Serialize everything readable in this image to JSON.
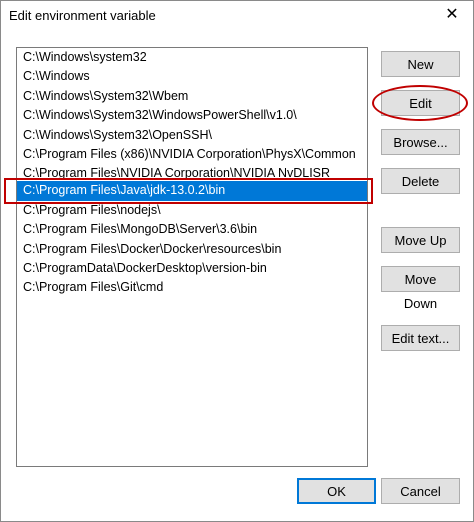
{
  "window": {
    "title": "Edit environment variable",
    "close_glyph": "✕"
  },
  "paths": [
    {
      "text": "C:\\Windows\\system32",
      "selected": false
    },
    {
      "text": "C:\\Windows",
      "selected": false
    },
    {
      "text": "C:\\Windows\\System32\\Wbem",
      "selected": false
    },
    {
      "text": "C:\\Windows\\System32\\WindowsPowerShell\\v1.0\\",
      "selected": false
    },
    {
      "text": "C:\\Windows\\System32\\OpenSSH\\",
      "selected": false
    },
    {
      "text": "C:\\Program Files (x86)\\NVIDIA Corporation\\PhysX\\Common",
      "selected": false
    },
    {
      "text": "C:\\Program Files\\NVIDIA Corporation\\NVIDIA NvDLISR",
      "selected": false,
      "clipped": true
    },
    {
      "text": "C:\\Program Files\\Java\\jdk-13.0.2\\bin",
      "selected": true
    },
    {
      "text": "C:\\Program Files\\nodejs\\",
      "selected": false
    },
    {
      "text": "C:\\Program Files\\MongoDB\\Server\\3.6\\bin",
      "selected": false
    },
    {
      "text": "C:\\Program Files\\Docker\\Docker\\resources\\bin",
      "selected": false
    },
    {
      "text": "C:\\ProgramData\\DockerDesktop\\version-bin",
      "selected": false
    },
    {
      "text": "C:\\Program Files\\Git\\cmd",
      "selected": false
    }
  ],
  "buttons": {
    "new": "New",
    "edit": "Edit",
    "browse": "Browse...",
    "delete": "Delete",
    "move_up": "Move Up",
    "move_down": "Move Down",
    "edit_text": "Edit text...",
    "ok": "OK",
    "cancel": "Cancel"
  },
  "colors": {
    "selection": "#0078d7",
    "annotation": "#c00000",
    "button_face": "#e1e1e1"
  }
}
